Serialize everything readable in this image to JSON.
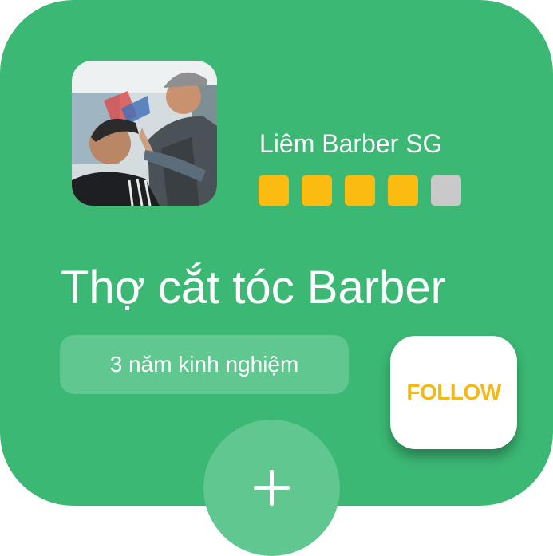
{
  "profile": {
    "name": "Liêm Barber SG",
    "photo_icon": "barber-photo",
    "rating": 4,
    "rating_max": 5
  },
  "job": {
    "title": "Thợ cắt tóc Barber",
    "experience": "3 năm kinh nghiệm"
  },
  "actions": {
    "follow_label": "FOLLOW",
    "add_icon": "plus-icon"
  },
  "colors": {
    "card": "#3bb873",
    "pill": "#5fc78f",
    "star_filled": "#fbbb10",
    "star_empty": "#c9c9c9",
    "follow_text": "#f2b91a"
  }
}
